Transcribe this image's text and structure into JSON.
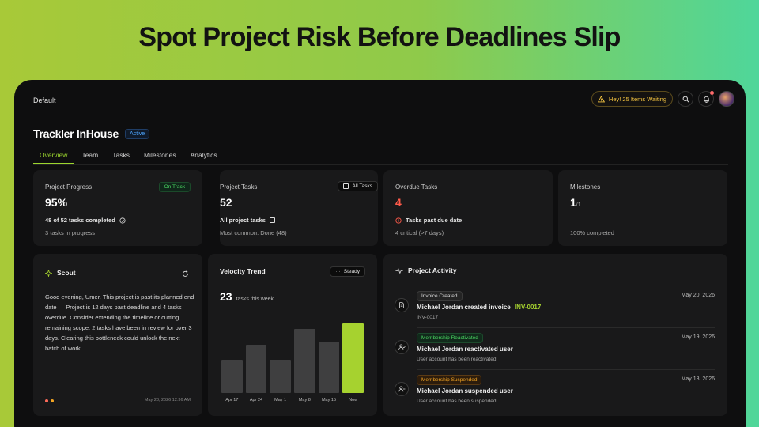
{
  "headline": "Spot Project Risk Before Deadlines Slip",
  "topbar": {
    "workspace": "Default",
    "notice": "Hey! 25 Items Waiting"
  },
  "project": {
    "title": "Trackler InHouse",
    "status": "Active"
  },
  "tabs": [
    "Overview",
    "Team",
    "Tasks",
    "Milestones",
    "Analytics"
  ],
  "stats": {
    "progress": {
      "label": "Project Progress",
      "badge": "On Track",
      "value": "95%",
      "line1": "48 of 52 tasks completed",
      "line2": "3 tasks in progress"
    },
    "tasks": {
      "label": "Project Tasks",
      "badge": "All Tasks",
      "value": "52",
      "line1": "All project tasks",
      "line2": "Most common: Done (48)"
    },
    "overdue": {
      "label": "Overdue Tasks",
      "value": "4",
      "line1": "Tasks past due date",
      "line2": "4 critical (>7 days)"
    },
    "milestones": {
      "label": "Milestones",
      "value": "1",
      "value_sub": "/1",
      "line2": "100% completed"
    }
  },
  "scout": {
    "title": "Scout",
    "text": "Good evening, Umer. This project is past its planned end date — Project is 12 days past deadline and 4 tasks overdue. Consider extending the timeline or cutting remaining scope. 2 tasks have been in review for over 3 days. Clearing this bottleneck could unlock the next batch of work.",
    "timestamp": "May 28, 2026 12:36 AM"
  },
  "velocity": {
    "title": "Velocity Trend",
    "badge": "Steady",
    "value": "23",
    "value_caption": "tasks this week"
  },
  "chart_data": {
    "type": "bar",
    "categories": [
      "Apr 17",
      "Apr 24",
      "May 1",
      "May 8",
      "May 15",
      "Now"
    ],
    "values": [
      11,
      16,
      11,
      21,
      17,
      23
    ],
    "ylim": [
      0,
      25
    ],
    "colors": {
      "default": "#3f3f40",
      "highlight": "#a6d22f"
    }
  },
  "activity": {
    "title": "Project Activity",
    "items": [
      {
        "tag": "Invoice Created",
        "title": "Michael Jordan created invoice",
        "ref": "INV-0017",
        "sub": "INV-0017",
        "date": "May 20, 2026",
        "icon": "file-icon"
      },
      {
        "tag": "Membership Reactivated",
        "title": "Michael Jordan reactivated user",
        "sub": "User account has been reactivated",
        "date": "May 19, 2026",
        "icon": "user-check-icon"
      },
      {
        "tag": "Membership Suspended",
        "title": "Michael Jordan suspended user",
        "sub": "User account has been suspended",
        "date": "May 18, 2026",
        "icon": "user-minus-icon"
      }
    ]
  },
  "colors": {
    "accent": "#9cd62e",
    "danger": "#ff5a4a",
    "warning": "#f5c542",
    "success": "#4cd964"
  }
}
